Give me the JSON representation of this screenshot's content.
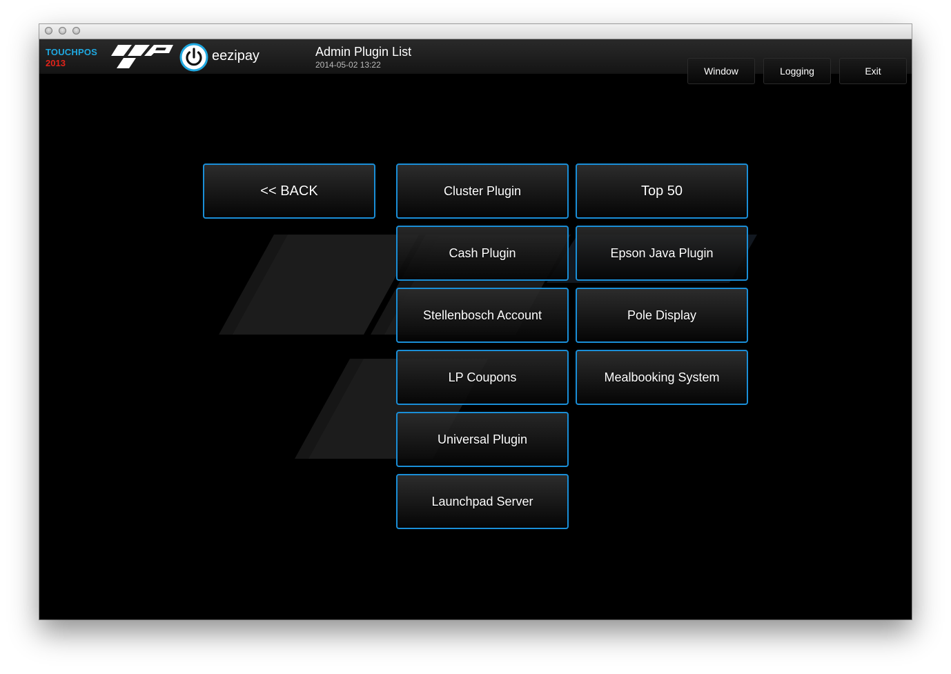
{
  "brand": {
    "name": "TOUCHPOS",
    "year": "2013",
    "pay_name": "eezipay"
  },
  "header": {
    "title": "Admin Plugin List",
    "timestamp": "2014-05-02 13:22",
    "buttons": {
      "window": "Window",
      "logging": "Logging",
      "exit": "Exit"
    }
  },
  "main": {
    "back": "<< BACK",
    "plugins": [
      "Cluster Plugin",
      "Top 50",
      "Cash Plugin",
      "Epson Java Plugin",
      "Stellenbosch Account",
      "Pole Display",
      "LP Coupons",
      "Mealbooking System",
      "Universal Plugin",
      "Launchpad Server"
    ]
  },
  "colors": {
    "accent": "#1a8fd8",
    "brand_blue": "#1fa8e0",
    "brand_red": "#e2231a",
    "background": "#000000"
  },
  "icons": {
    "app_logo": "tp-logo-icon",
    "pay_logo": "power-icon"
  }
}
